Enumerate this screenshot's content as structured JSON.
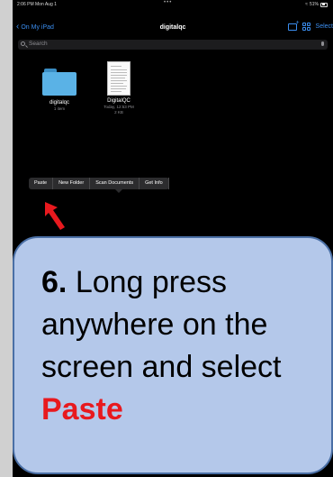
{
  "status_bar": {
    "time": "2:06 PM  Mon Aug 1",
    "dots": "•••",
    "battery": "51%"
  },
  "nav": {
    "back_label": "On My iPad",
    "title": "digitalqc",
    "select_label": "Select"
  },
  "search": {
    "placeholder": "Search"
  },
  "files": [
    {
      "name": "digitalqc",
      "meta": "1 item",
      "type": "folder"
    },
    {
      "name": "DigitalQC",
      "meta_line1": "Today, 12:53 PM",
      "meta_line2": "2 KB",
      "type": "document"
    }
  ],
  "context_menu": {
    "items": [
      "Paste",
      "New Folder",
      "Scan Documents",
      "Get Info"
    ]
  },
  "callout": {
    "step_number": "6.",
    "text_before": "Long press anywhere on the screen and select",
    "highlight": "Paste"
  },
  "colors": {
    "accent": "#3b8ef0",
    "folder": "#5ab2e6",
    "arrow": "#e8191e",
    "callout_bg": "#b4c8ea",
    "callout_border": "#4a6fa5"
  }
}
